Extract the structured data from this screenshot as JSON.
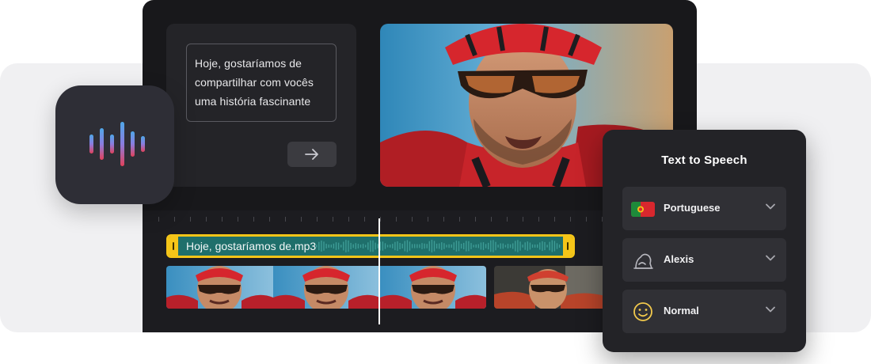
{
  "script": {
    "text": "Hoje, gostaríamos de compartilhar com vocês uma história fascinante",
    "submit_icon": "arrow-right-icon"
  },
  "timeline": {
    "audio_clip_label": "Hoje, gostaríamos de.mp3"
  },
  "tts_panel": {
    "title": "Text to Speech",
    "language": {
      "label": "Portuguese",
      "icon": "portugal-flag-icon"
    },
    "voice": {
      "label": "Alexis",
      "icon": "voice-avatar-icon"
    },
    "style": {
      "label": "Normal",
      "icon": "smiley-icon"
    }
  },
  "colors": {
    "accent_clip_border": "#f5c518",
    "audio_clip_fill": "#1f6f6b",
    "panel_bg": "#232327",
    "editor_bg": "#18181b"
  }
}
